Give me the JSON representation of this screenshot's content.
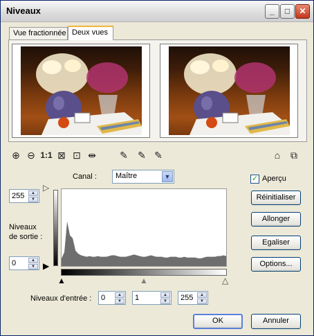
{
  "window": {
    "title": "Niveaux"
  },
  "titlebar_buttons": {
    "minimize": "_",
    "maximize": "□",
    "close": "✕"
  },
  "tabs": [
    {
      "label": "Vue fractionnée"
    },
    {
      "label": "Deux vues"
    }
  ],
  "active_tab": "Deux vues",
  "toolbar": {
    "zoom_in_icon": "zoom-in-icon",
    "zoom_out_icon": "zoom-out-icon",
    "actual_size_label": "1:1",
    "fit_icon": "fit-window-icon",
    "zoom_window_icon": "zoom-window-icon",
    "pan_icon": "pan-icon",
    "black_picker_icon": "eyedropper-black-icon",
    "gray_picker_icon": "eyedropper-gray-icon",
    "white_picker_icon": "eyedropper-white-icon"
  },
  "canal": {
    "label": "Canal :",
    "value": "Maître"
  },
  "apercu": {
    "label": "Aperçu",
    "checked": true
  },
  "output": {
    "label_line1": "Niveaux",
    "label_line2": "de sortie :",
    "max": "255",
    "min": "0"
  },
  "input": {
    "label": "Niveaux d'entrée :",
    "black": "0",
    "gamma": "1",
    "white": "255"
  },
  "buttons": {
    "reset": "Réinitialiser",
    "stretch": "Allonger",
    "equalize": "Egaliser",
    "options": "Options...",
    "ok": "OK",
    "cancel": "Annuler"
  },
  "histogram": {
    "values": [
      0.1,
      0.18,
      0.58,
      0.4,
      0.36,
      0.2,
      0.16,
      0.14,
      0.13,
      0.12,
      0.13,
      0.12,
      0.12,
      0.13,
      0.12,
      0.12,
      0.12,
      0.13,
      0.14,
      0.14,
      0.13,
      0.12,
      0.12,
      0.12,
      0.13,
      0.14,
      0.15,
      0.14,
      0.13,
      0.12,
      0.12,
      0.13,
      0.14,
      0.13,
      0.12,
      0.12,
      0.12,
      0.11,
      0.11,
      0.12,
      0.12,
      0.12,
      0.11,
      0.11,
      0.12,
      0.11,
      0.11,
      0.11,
      0.11,
      0.1,
      0.1,
      0.11,
      0.12,
      0.12,
      0.12,
      0.12,
      0.13,
      0.13,
      0.14,
      0.13
    ],
    "fill_color": "#6e6e6e"
  }
}
